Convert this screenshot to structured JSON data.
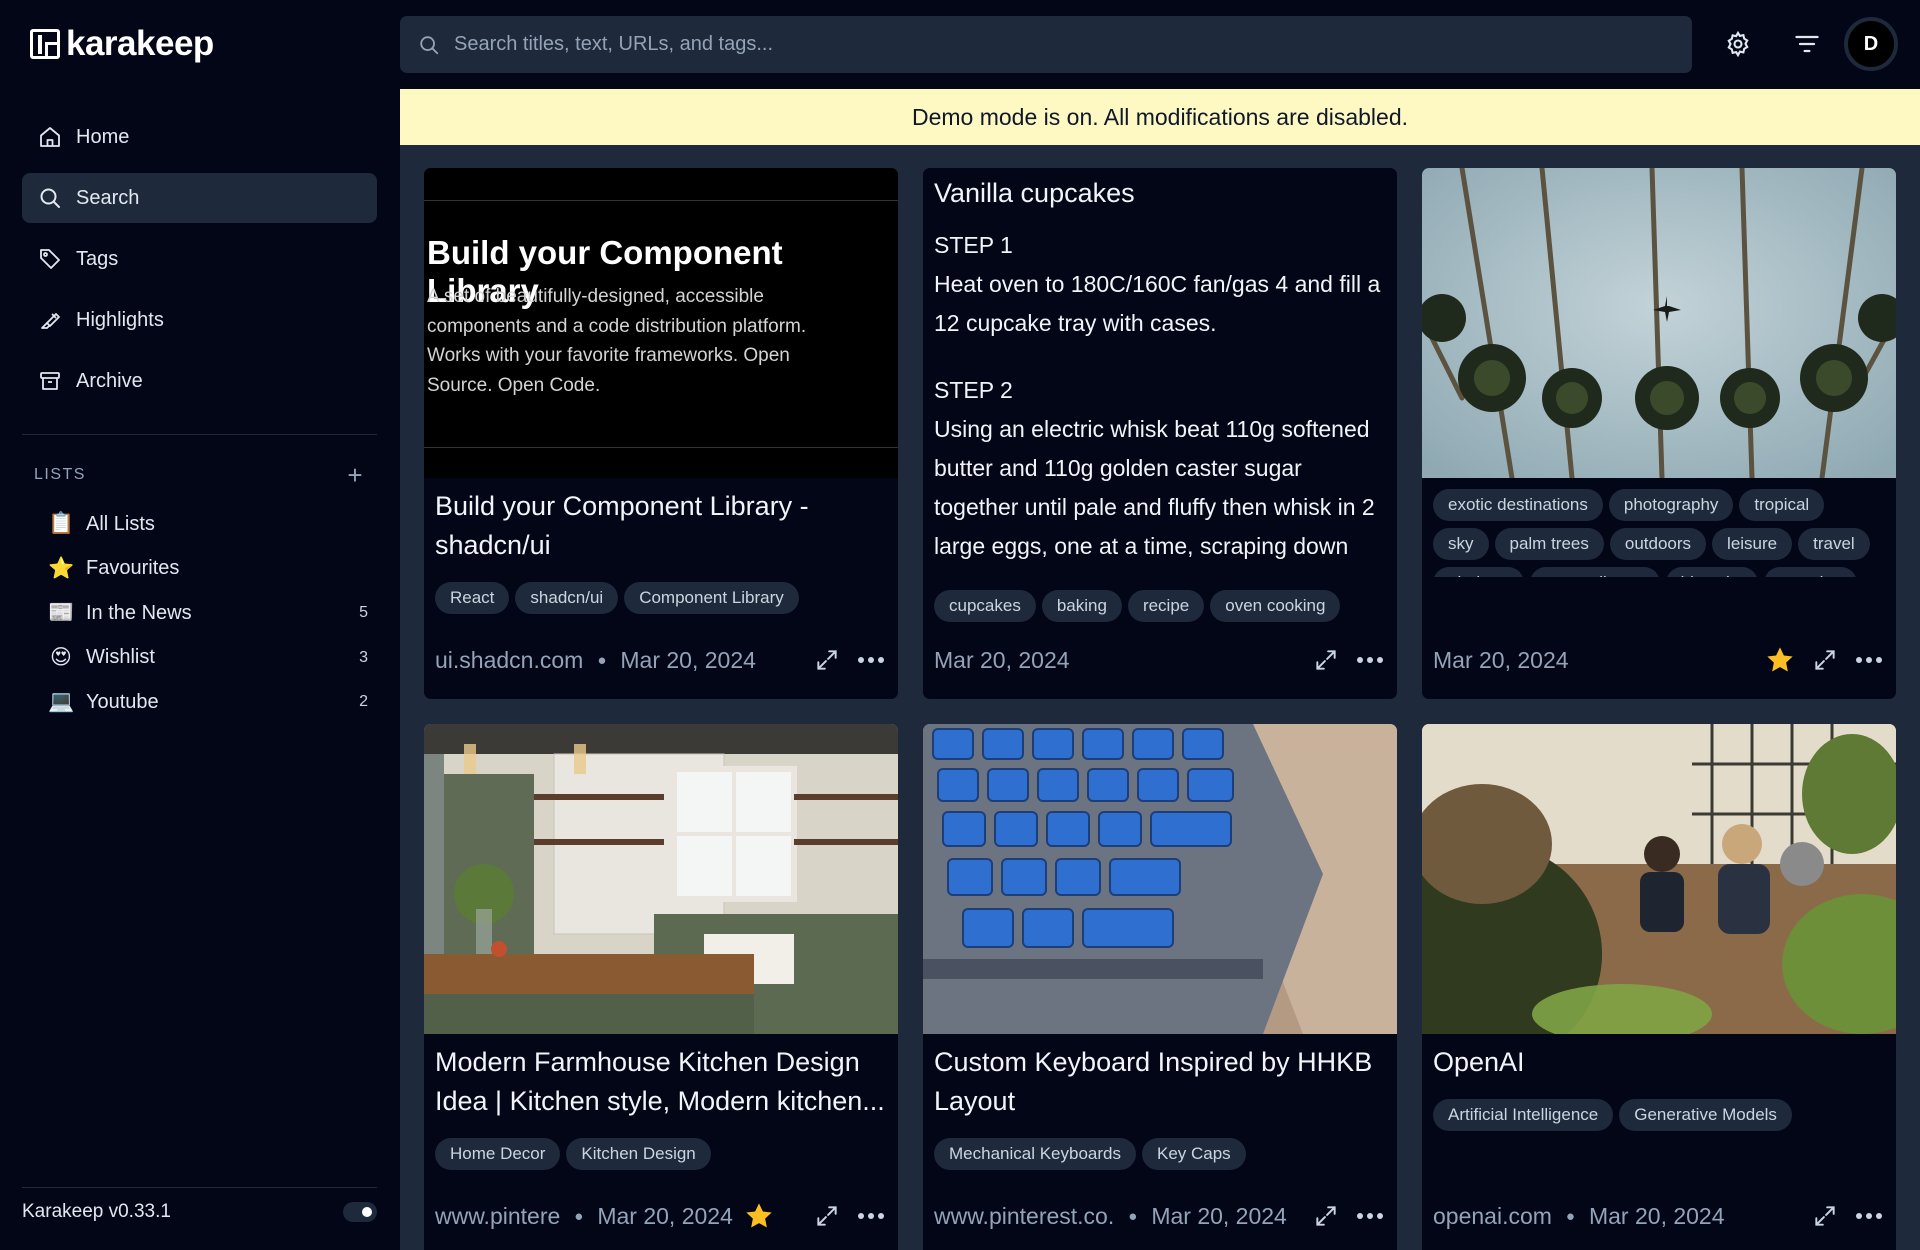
{
  "app": {
    "name": "karakeep",
    "version": "Karakeep v0.33.1"
  },
  "search": {
    "placeholder": "Search titles, text, URLs, and tags..."
  },
  "avatar": {
    "initial": "D"
  },
  "nav": [
    {
      "label": "Home",
      "icon": "home-icon"
    },
    {
      "label": "Search",
      "icon": "search-icon",
      "active": true
    },
    {
      "label": "Tags",
      "icon": "tag-icon"
    },
    {
      "label": "Highlights",
      "icon": "highlighter-icon"
    },
    {
      "label": "Archive",
      "icon": "archive-icon"
    }
  ],
  "lists": {
    "header": "LISTS",
    "items": [
      {
        "emoji": "📋",
        "label": "All Lists",
        "count": ""
      },
      {
        "emoji": "⭐",
        "label": "Favourites",
        "count": ""
      },
      {
        "emoji": "📰",
        "label": "In the News",
        "count": "5"
      },
      {
        "emoji": "😍",
        "label": "Wishlist",
        "count": "3"
      },
      {
        "emoji": "💻",
        "label": "Youtube",
        "count": "2"
      }
    ]
  },
  "banner": "Demo mode is on. All modifications are disabled.",
  "cards": [
    {
      "preview": {
        "heading": "Build your Component Library",
        "body": "A set of beautifully-designed, accessible components and a code distribution platform. Works with your favorite frameworks. Open Source. Open Code."
      },
      "title": "Build your Component Library - shadcn/ui",
      "tags": [
        "React",
        "shadcn/ui",
        "Component Library"
      ],
      "source": "ui.shadcn.com",
      "date": "Mar 20, 2024",
      "favourite": false
    },
    {
      "title": "Vanilla cupcakes",
      "steps": [
        {
          "label": "STEP 1",
          "text": "Heat oven to 180C/160C fan/gas 4 and fill a 12 cupcake tray with cases."
        },
        {
          "label": "STEP 2",
          "text": "Using an electric whisk beat 110g softened butter and 110g golden caster sugar together until pale and fluffy then whisk in 2 large eggs, one at a time, scraping down"
        }
      ],
      "tags": [
        "cupcakes",
        "baking",
        "recipe",
        "oven cooking"
      ],
      "source": "",
      "date": "Mar 20, 2024",
      "favourite": false
    },
    {
      "image": "palm-trees-photo",
      "tags": [
        "exotic destinations",
        "photography",
        "tropical",
        "sky",
        "palm trees",
        "outdoors",
        "leisure",
        "travel",
        "airplane",
        "warm climate",
        "blue sky",
        "vacation"
      ],
      "source": "",
      "date": "Mar 20, 2024",
      "favourite": true
    },
    {
      "image": "kitchen-photo",
      "title": "Modern Farmhouse Kitchen Design Idea | Kitchen style, Modern kitchen...",
      "tags": [
        "Home Decor",
        "Kitchen Design"
      ],
      "source": "www.pintere",
      "date": "Mar 20, 2024",
      "favourite": true
    },
    {
      "image": "keyboard-photo",
      "title": "Custom Keyboard Inspired by HHKB Layout",
      "tags": [
        "Mechanical Keyboards",
        "Key Caps"
      ],
      "source": "www.pinterest.co.",
      "date": "Mar 20, 2024",
      "favourite": false
    },
    {
      "image": "office-plants-photo",
      "title": "OpenAI",
      "tags": [
        "Artificial Intelligence",
        "Generative Models"
      ],
      "source": "openai.com",
      "date": "Mar 20, 2024",
      "favourite": false
    }
  ],
  "colors": {
    "accent_star": "#fbbf24",
    "banner_bg": "#fef9c3",
    "main_bg": "#1e293b",
    "card_bg": "#020617"
  }
}
